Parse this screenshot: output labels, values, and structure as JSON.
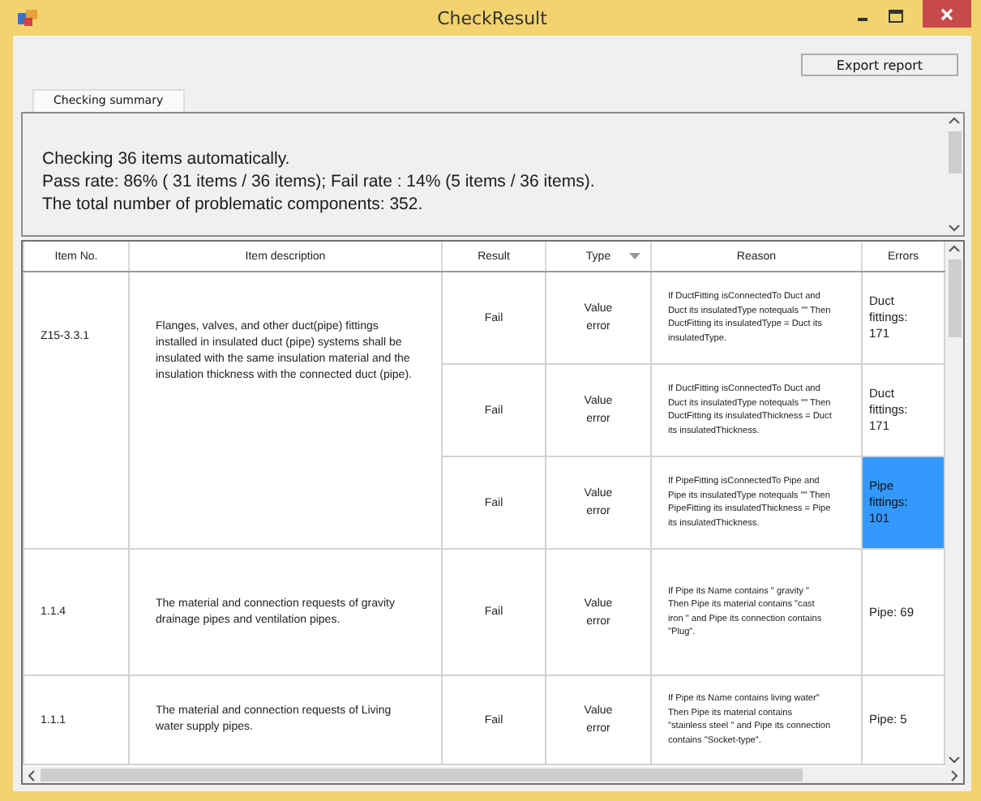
{
  "window": {
    "title": "CheckResult"
  },
  "toolbar": {
    "export_button": "Export report"
  },
  "tabs": [
    {
      "label": "Checking summary",
      "selected": true
    }
  ],
  "summary": {
    "lines": [
      "Checking  36 items automatically.",
      "Pass rate:  86% ( 31 items / 36 items); Fail rate :  14% (5 items / 36 items).",
      "The total number of problematic components: 352."
    ]
  },
  "table": {
    "columns": [
      "Item No.",
      "Item description",
      "Result",
      "Type",
      "Reason",
      "Errors"
    ],
    "rows": [
      {
        "item_no": "Z15-3.3.1",
        "description": "Flanges, valves, and other duct(pipe) fittings installed in insulated duct (pipe) systems shall be insulated with the same insulation material and the insulation thickness with the connected duct (pipe).",
        "checks": [
          {
            "result": "Fail",
            "type": "Value error",
            "reason": "If DuctFitting isConnectedTo Duct and Duct  its insulatedType notequals \"\"   Then  DuctFitting its insulatedType = Duct its insulatedType.",
            "errors": "Duct fittings: 171",
            "selected": false
          },
          {
            "result": "Fail",
            "type": "Value error",
            "reason": "If DuctFitting isConnectedTo Duct and Duct  its insulatedType notequals \"\"   Then  DuctFitting its insulatedThickness = Duct its insulatedThickness.",
            "errors": "Duct fittings: 171",
            "selected": false
          },
          {
            "result": "Fail",
            "type": "Value error",
            "reason": "If PipeFitting isConnectedTo Pipe and Pipe  its insulatedType notequals \"\"   Then  PipeFitting its insulatedThickness = Pipe its insulatedThickness.",
            "errors": "Pipe fittings: 101",
            "selected": true
          }
        ]
      },
      {
        "item_no": "1.1.4",
        "description": "The material and connection requests of gravity drainage pipes and ventilation pipes.",
        "checks": [
          {
            "result": "Fail",
            "type": "Value error",
            "reason": "If Pipe its Name contains  \" gravity \"  Then  Pipe its material contains \"cast iron \" and Pipe its connection contains \"Plug\".",
            "errors": "Pipe: 69",
            "selected": false
          }
        ]
      },
      {
        "item_no": "1.1.1",
        "description": "The material and connection requests of Living water supply pipes.",
        "checks": [
          {
            "result": "Fail",
            "type": "Value error",
            "reason": "If Pipe its Name contains  living water\"   Then  Pipe its material contains \"stainless steel \" and Pipe its connection contains \"Socket-type\".",
            "errors": "Pipe: 5",
            "selected": false
          }
        ]
      }
    ]
  }
}
